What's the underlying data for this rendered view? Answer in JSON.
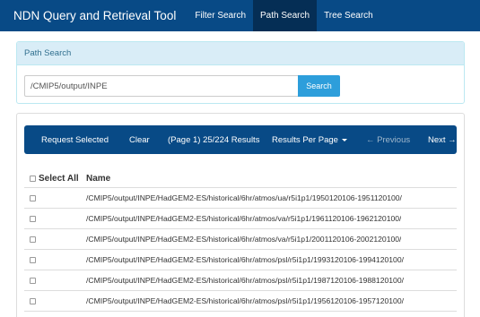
{
  "navbar": {
    "brand": "NDN Query and Retrieval Tool",
    "links": [
      "Filter Search",
      "Path Search",
      "Tree Search"
    ],
    "active": "Path Search"
  },
  "path_search": {
    "heading": "Path Search",
    "input_value": "/CMIP5/output/INPE",
    "button_label": "Search"
  },
  "results_bar": {
    "request_selected": "Request Selected",
    "clear": "Clear",
    "page_info": "(Page 1) 25/224 Results",
    "per_page": "Results Per Page",
    "previous": "← Previous",
    "next": "Next →"
  },
  "table": {
    "select_all": "Select All",
    "name_header": "Name",
    "rows": [
      "/CMIP5/output/INPE/HadGEM2-ES/historical/6hr/atmos/ua/r5i1p1/1950120106-1951120100/",
      "/CMIP5/output/INPE/HadGEM2-ES/historical/6hr/atmos/va/r5i1p1/1961120106-1962120100/",
      "/CMIP5/output/INPE/HadGEM2-ES/historical/6hr/atmos/va/r5i1p1/2001120106-2002120100/",
      "/CMIP5/output/INPE/HadGEM2-ES/historical/6hr/atmos/psl/r5i1p1/1993120106-1994120100/",
      "/CMIP5/output/INPE/HadGEM2-ES/historical/6hr/atmos/psl/r5i1p1/1987120106-1988120100/",
      "/CMIP5/output/INPE/HadGEM2-ES/historical/6hr/atmos/psl/r5i1p1/1956120106-1957120100/"
    ]
  }
}
